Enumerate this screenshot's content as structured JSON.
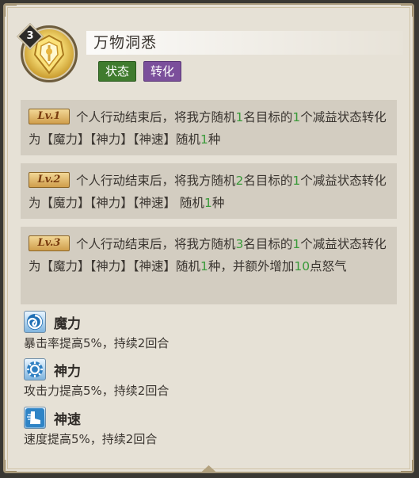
{
  "skill": {
    "level": "3",
    "name": "万物洞悉",
    "tags": [
      "状态",
      "转化"
    ],
    "icon": "golden-shield-icon"
  },
  "levels": [
    {
      "badge": "Lv.1",
      "parts": [
        "个人行动结束后，将我方随机",
        "1",
        "名目标的",
        "1",
        "个减益状态转化为【魔力】【神力】【神速】随机",
        "1",
        "种"
      ]
    },
    {
      "badge": "Lv.2",
      "parts": [
        "个人行动结束后，将我方随机",
        "2",
        "名目标的",
        "1",
        "个减益状态转化为【魔力】【神力】【神速】 随机",
        "1",
        "种"
      ]
    },
    {
      "badge": "Lv.3",
      "parts": [
        "个人行动结束后，将我方随机",
        "3",
        "名目标的",
        "1",
        "个减益状态转化为【魔力】【神力】【神速】随机",
        "1",
        "种，并额外增加",
        "10",
        "点怒气"
      ]
    }
  ],
  "buffs": [
    {
      "name": "魔力",
      "desc": "暴击率提高5%，持续2回合",
      "icon": "swirl-icon"
    },
    {
      "name": "神力",
      "desc": "攻击力提高5%，持续2回合",
      "icon": "sun-gear-icon"
    },
    {
      "name": "神速",
      "desc": "速度提高5%，持续2回合",
      "icon": "winged-boot-icon"
    }
  ],
  "colors": {
    "highlight": "#3a9a3a",
    "tag_state": "#3f7b2e",
    "tag_convert": "#7b4f9b",
    "panel_bg": "#e6e1d6"
  }
}
